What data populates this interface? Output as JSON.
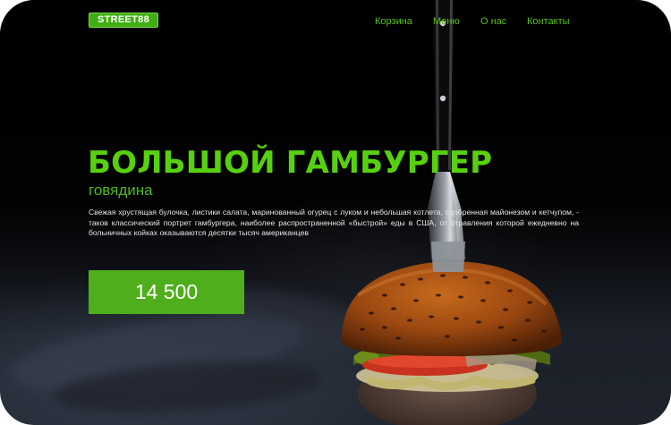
{
  "header": {
    "logo": "STREET88",
    "nav": [
      "Корзина",
      "Меню",
      "О нас",
      "Контакты"
    ]
  },
  "hero": {
    "title": "БОЛЬШОЙ ГАМБУРГЕР",
    "subtitle": "говядина",
    "description": "Свежая хрустящая булочка, листики салата, маринованный огурец с луком и небольшая котлета, сдобренная майонезом и кетчупом, - таков классический портрет гамбургера, наиболее распространенной «быстрой» еды в США, от отравления которой ежедневно на больничных койках оказываются десятки тысяч американцев",
    "price": "14 500"
  },
  "colors": {
    "accent_green": "#4fae1c",
    "title_green": "#57d10f",
    "background": "#000000"
  },
  "icons": [
    "knife-image",
    "burger-image"
  ]
}
